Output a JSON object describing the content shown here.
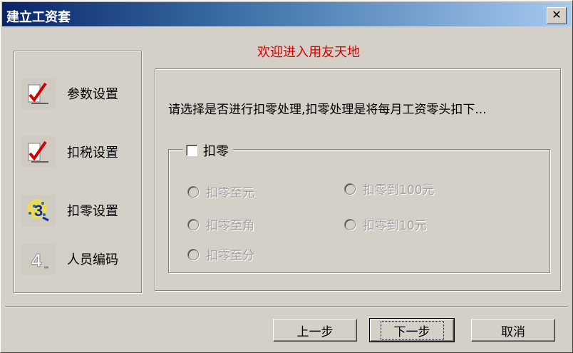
{
  "window": {
    "title": "建立工资套",
    "close_glyph": "✕"
  },
  "welcome": "欢迎进入用友天地",
  "steps": [
    {
      "label": "参数设置",
      "icon": "checkmark-icon"
    },
    {
      "label": "扣税设置",
      "icon": "checkmark-icon"
    },
    {
      "label": "扣零设置",
      "icon": "step-3-icon"
    },
    {
      "label": "人员编码",
      "icon": "step-4-icon"
    }
  ],
  "prompt": "请选择是否进行扣零处理,扣零处理是将每月工资零头扣下...",
  "round_group": {
    "checkbox_label": "扣零",
    "checked": false,
    "options": [
      {
        "label": "扣零至元"
      },
      {
        "label": "扣零到100元"
      },
      {
        "label": "扣零至角"
      },
      {
        "label": "扣零到10元"
      },
      {
        "label": "扣零至分"
      }
    ]
  },
  "buttons": {
    "prev": "上一步",
    "next": "下一步",
    "cancel": "取消"
  },
  "colors": {
    "welcome": "#d40000",
    "title_bar_start": "#0a246a",
    "title_bar_end": "#a6caf0"
  }
}
